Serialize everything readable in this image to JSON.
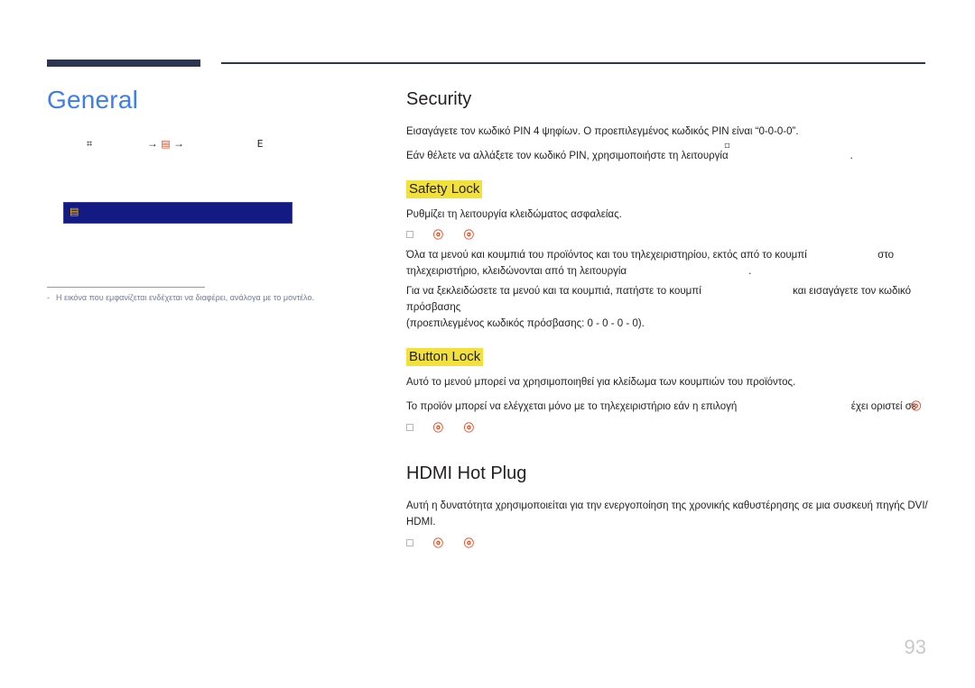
{
  "document": {
    "chapter_title": "General",
    "page_number": "93",
    "accent_color": "#3c7df0",
    "rule_color": "#2e3551",
    "highlight_color": "#f2e03c",
    "menu_bar_color": "#141a84",
    "menu_label_color": "#ffbf00",
    "footnote_color": "#6f7b96"
  },
  "left": {
    "nav_path": {
      "icon_start": "⌗",
      "arrow_1": "→",
      "icon_mid": "▤",
      "arrow_2": "→",
      "icon_end": "E"
    },
    "menu_bar": {
      "label_glyph": "▤"
    },
    "footnote": {
      "dash": "-",
      "text": "Η εικόνα που εμφανίζεται ενδέχεται να διαφέρει, ανάλογα με το μοντέλο."
    }
  },
  "right": {
    "security": {
      "heading": "Security",
      "paragraph_1": "Εισαγάγετε τον κωδικό PIN 4 ψηφίων. Ο προεπιλεγμένος κωδικός PIN είναι “0-0-0-0”.",
      "paragraph_2": "Εάν θέλετε να αλλάξετε τον κωδικό PIN, χρησιμοποιήστε τη λειτουργία",
      "paragraph_2_trail": ".",
      "faint_mark": "▫",
      "safety_lock": {
        "sub_heading": "Safety Lock",
        "description": "Ρυθμίζει τη λειτουργία κλειδώματος ασφαλείας.",
        "options": {
          "box": "",
          "glyph_off": "ⓞ",
          "glyph_on": "ⓞ"
        },
        "paragraph_a_1": "Όλα τα μενού και κουμπιά του προϊόντος και του τηλεχειριστηρίου, εκτός από το κουμπί",
        "paragraph_a_2": "στο",
        "paragraph_a_3": "τηλεχειριστήριο, κλειδώνονται από τη λειτουργία",
        "paragraph_a_trail": ".",
        "paragraph_b_1": "Για να ξεκλειδώσετε τα μενού και τα κουμπιά, πατήστε το κουμπί",
        "paragraph_b_2": "και εισαγάγετε τον κωδικό πρόσβασης",
        "paragraph_b_3": "(προεπιλεγμένος κωδικός πρόσβασης: 0 - 0 - 0 - 0)."
      },
      "button_lock": {
        "sub_heading": "Button Lock",
        "description": "Αυτό το μενού μπορεί να χρησιμοποιηθεί για κλείδωμα των κουμπιών του προϊόντος.",
        "paragraph_1": "Το προϊόν μπορεί να ελέγχεται μόνο με το τηλεχειριστήριο εάν η επιλογή",
        "paragraph_2": "έχει οριστεί σε",
        "overlap_glyph": "ⓞ",
        "options": {
          "box": "",
          "glyph_off": "ⓞ",
          "glyph_on": "ⓞ"
        }
      }
    },
    "hdmi_hot_plug": {
      "heading": "HDMI Hot Plug",
      "paragraph_1": "Αυτή η δυνατότητα χρησιμοποιείται για την ενεργοποίηση της χρονικής καθυστέρησης σε μια συσκευή πηγής DVI/ HDMI.",
      "options": {
        "box": "",
        "glyph_off": "ⓞ",
        "glyph_on": "ⓞ"
      }
    }
  }
}
